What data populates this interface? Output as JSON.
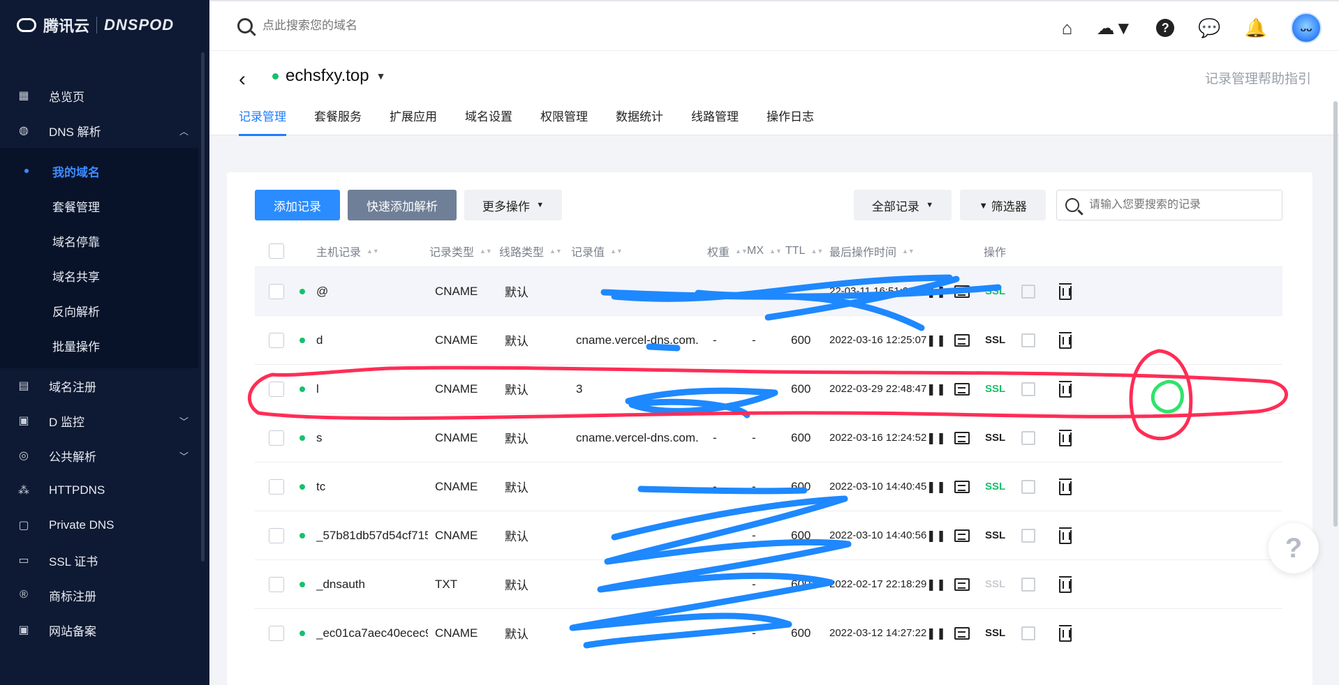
{
  "brand": {
    "tencent": "腾讯云",
    "dnspod": "DNSPOD"
  },
  "sidebar": {
    "items_top": [
      {
        "label": "总览页",
        "icon": "dashboard-icon"
      },
      {
        "label": "DNS 解析",
        "icon": "globe-icon",
        "chevron": "up"
      }
    ],
    "subitems": [
      {
        "label": "我的域名",
        "active": true
      },
      {
        "label": "套餐管理"
      },
      {
        "label": "域名停靠"
      },
      {
        "label": "域名共享"
      },
      {
        "label": "反向解析"
      },
      {
        "label": "批量操作"
      }
    ],
    "items_bottom": [
      {
        "label": "域名注册",
        "icon": "calendar-icon"
      },
      {
        "label": "D 监控",
        "icon": "monitor-icon",
        "chevron": "down"
      },
      {
        "label": "公共解析",
        "icon": "public-dns-icon",
        "chevron": "down"
      },
      {
        "label": "HTTPDNS",
        "icon": "httpdns-icon"
      },
      {
        "label": "Private DNS",
        "icon": "private-dns-icon"
      },
      {
        "label": "SSL 证书",
        "icon": "certificate-icon"
      },
      {
        "label": "商标注册",
        "icon": "trademark-icon"
      },
      {
        "label": "网站备案",
        "icon": "record-filing-icon"
      }
    ]
  },
  "topbar": {
    "search_placeholder": "点此搜索您的域名"
  },
  "domain": {
    "name": "echsfxy.top",
    "help": "记录管理帮助指引"
  },
  "tabs": [
    "记录管理",
    "套餐服务",
    "扩展应用",
    "域名设置",
    "权限管理",
    "数据统计",
    "线路管理",
    "操作日志"
  ],
  "toolbar": {
    "add": "添加记录",
    "quick_add": "快速添加解析",
    "more": "更多操作",
    "all_records": "全部记录",
    "filter": "筛选器",
    "search_placeholder": "请输入您要搜索的记录"
  },
  "table": {
    "headers": {
      "host": "主机记录",
      "type": "记录类型",
      "line": "线路类型",
      "value": "记录值",
      "weight": "权重",
      "mx": "MX",
      "ttl": "TTL",
      "time": "最后操作时间",
      "ops": "操作"
    },
    "ssl_label": "SSL",
    "rows": [
      {
        "host": "@",
        "type": "CNAME",
        "line": "默认",
        "value": "",
        "weight": "",
        "mx": "",
        "ttl": "",
        "time": "22-03-11 16:51:20",
        "ssl": "green"
      },
      {
        "host": "d",
        "type": "CNAME",
        "line": "默认",
        "value": "cname.vercel-dns.com.",
        "weight": "-",
        "mx": "-",
        "ttl": "600",
        "time": "2022-03-16 12:25:07",
        "ssl": "black"
      },
      {
        "host": "l",
        "type": "CNAME",
        "line": "默认",
        "value": "3",
        "weight": "-",
        "mx": "-",
        "ttl": "600",
        "time": "2022-03-29 22:48:47",
        "ssl": "green"
      },
      {
        "host": "s",
        "type": "CNAME",
        "line": "默认",
        "value": "cname.vercel-dns.com.",
        "weight": "-",
        "mx": "-",
        "ttl": "600",
        "time": "2022-03-16 12:24:52",
        "ssl": "black"
      },
      {
        "host": "tc",
        "type": "CNAME",
        "line": "默认",
        "value": "",
        "weight": "-",
        "mx": "-",
        "ttl": "600",
        "time": "2022-03-10 14:40:45",
        "ssl": "green"
      },
      {
        "host": "_57b81db57d54cf715…",
        "type": "CNAME",
        "line": "默认",
        "value": "",
        "weight": "-",
        "mx": "-",
        "ttl": "600",
        "time": "2022-03-10 14:40:56",
        "ssl": "black"
      },
      {
        "host": "_dnsauth",
        "type": "TXT",
        "line": "默认",
        "value": "",
        "weight": "",
        "mx": "-",
        "ttl": "600",
        "time": "2022-02-17 22:18:29",
        "ssl": "gray"
      },
      {
        "host": "_ec01ca7aec40ecec9…",
        "type": "CNAME",
        "line": "默认",
        "value": "",
        "weight": "-",
        "mx": "-",
        "ttl": "600",
        "time": "2022-03-12 14:27:22",
        "ssl": "black"
      }
    ]
  },
  "colors": {
    "accent": "#2b8cff",
    "sidebar": "#0e1a33",
    "ssl_green": "#16c16b",
    "annotation_red": "#ff2d55",
    "scribble_blue": "#1e88ff"
  },
  "float_help": "?"
}
